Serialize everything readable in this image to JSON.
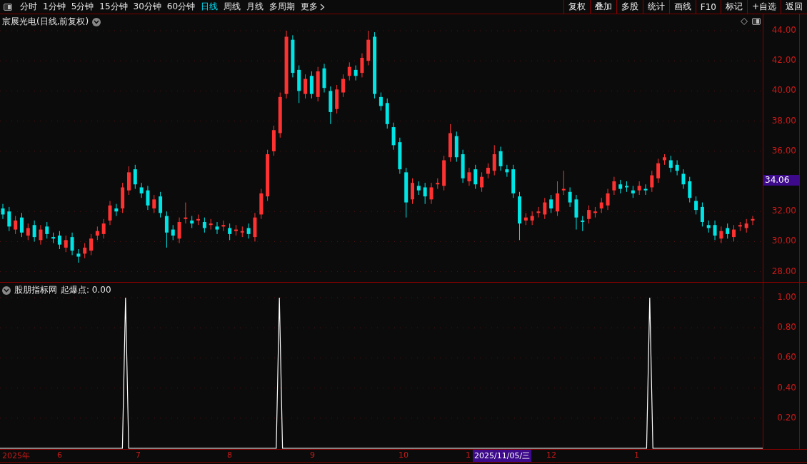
{
  "toolbar": {
    "periods": [
      {
        "label": "分时",
        "selected": false
      },
      {
        "label": "1分钟",
        "selected": false
      },
      {
        "label": "5分钟",
        "selected": false
      },
      {
        "label": "15分钟",
        "selected": false
      },
      {
        "label": "30分钟",
        "selected": false
      },
      {
        "label": "60分钟",
        "selected": false
      },
      {
        "label": "日线",
        "selected": true
      },
      {
        "label": "周线",
        "selected": false
      },
      {
        "label": "月线",
        "selected": false
      },
      {
        "label": "多周期",
        "selected": false
      },
      {
        "label": "更多",
        "selected": false
      }
    ],
    "actions": [
      "复权",
      "叠加",
      "多股",
      "统计",
      "画线",
      "F10",
      "标记",
      "+自选",
      "返回"
    ]
  },
  "main_chart": {
    "title": "宸展光电(日线,前复权)",
    "last_price": "34.06",
    "chart_data": {
      "type": "candlestick",
      "categories": [
        null,
        null,
        null,
        null,
        null,
        null,
        null,
        null,
        null,
        null,
        null,
        null,
        null,
        null,
        null,
        null,
        null,
        null,
        null,
        null,
        null,
        null,
        null,
        null,
        null,
        null,
        null,
        null,
        null,
        null,
        null,
        null,
        null,
        null,
        null,
        null,
        null,
        null,
        null,
        null,
        null,
        null,
        null,
        null,
        null,
        null,
        null,
        null,
        null,
        null,
        null,
        null,
        null,
        null,
        null,
        null,
        null,
        null,
        null,
        null,
        null,
        null,
        null,
        null,
        null,
        null,
        null,
        null,
        null,
        null,
        null,
        null,
        null,
        null,
        null,
        null,
        null,
        null,
        null,
        null,
        null,
        null,
        null,
        null,
        null,
        null,
        null,
        null,
        null,
        null,
        null,
        null,
        null,
        null,
        null,
        null,
        null,
        null,
        null,
        null,
        null,
        null,
        null,
        null,
        null,
        null,
        null,
        null,
        null,
        null,
        null,
        null,
        null,
        null,
        null,
        null,
        null,
        null,
        null,
        null
      ],
      "ohlc": [
        [
          32.2,
          32.5,
          31.5,
          31.8
        ],
        [
          32.0,
          32.3,
          30.7,
          31.0
        ],
        [
          30.8,
          31.7,
          30.5,
          31.4
        ],
        [
          31.6,
          31.9,
          30.3,
          30.6
        ],
        [
          30.4,
          31.2,
          30.1,
          30.9
        ],
        [
          31.1,
          31.4,
          30.0,
          30.3
        ],
        [
          30.1,
          31.1,
          29.8,
          30.8
        ],
        [
          31.0,
          31.3,
          30.2,
          30.5
        ],
        [
          30.3,
          30.6,
          29.9,
          30.2
        ],
        [
          30.4,
          30.7,
          29.5,
          29.8
        ],
        [
          29.6,
          30.4,
          29.3,
          30.1
        ],
        [
          30.3,
          30.6,
          29.1,
          29.4
        ],
        [
          29.2,
          29.5,
          28.6,
          29.0
        ],
        [
          29.2,
          29.9,
          28.9,
          29.6
        ],
        [
          29.4,
          30.5,
          29.1,
          30.2
        ],
        [
          30.4,
          31.0,
          30.1,
          30.7
        ],
        [
          30.5,
          31.5,
          30.2,
          31.2
        ],
        [
          31.4,
          32.7,
          31.1,
          32.4
        ],
        [
          32.2,
          32.5,
          31.7,
          32.0
        ],
        [
          32.2,
          33.9,
          31.9,
          33.6
        ],
        [
          33.4,
          35.0,
          33.1,
          34.6
        ],
        [
          34.8,
          35.1,
          33.5,
          33.8
        ],
        [
          33.6,
          33.9,
          32.9,
          33.2
        ],
        [
          33.4,
          33.7,
          32.1,
          32.4
        ],
        [
          32.2,
          33.1,
          31.9,
          32.8
        ],
        [
          33.0,
          33.3,
          31.6,
          31.9
        ],
        [
          31.7,
          32.0,
          29.6,
          30.6
        ],
        [
          30.8,
          31.1,
          30.1,
          30.4
        ],
        [
          30.2,
          31.6,
          29.9,
          31.3
        ],
        [
          31.5,
          32.6,
          31.2,
          31.6
        ],
        [
          31.4,
          31.7,
          30.9,
          31.2
        ],
        [
          31.4,
          31.8,
          31.1,
          31.5
        ],
        [
          31.3,
          31.6,
          30.6,
          30.9
        ],
        [
          31.1,
          31.5,
          30.8,
          31.2
        ],
        [
          31.0,
          31.3,
          30.5,
          30.8
        ],
        [
          31.0,
          31.4,
          30.7,
          31.1
        ],
        [
          30.9,
          31.2,
          30.1,
          30.5
        ],
        [
          30.7,
          31.1,
          30.4,
          30.8
        ],
        [
          30.6,
          31.0,
          30.3,
          30.7
        ],
        [
          30.9,
          31.2,
          30.2,
          30.5
        ],
        [
          30.3,
          31.9,
          30.0,
          31.6
        ],
        [
          31.8,
          33.5,
          31.5,
          33.2
        ],
        [
          33.0,
          36.1,
          32.7,
          35.8
        ],
        [
          36.0,
          37.7,
          35.7,
          37.4
        ],
        [
          37.2,
          39.9,
          36.9,
          39.6
        ],
        [
          39.8,
          44.0,
          39.5,
          43.6
        ],
        [
          43.4,
          43.7,
          40.9,
          41.2
        ],
        [
          41.4,
          41.7,
          39.2,
          40.0
        ],
        [
          39.8,
          41.1,
          39.5,
          40.8
        ],
        [
          41.0,
          41.3,
          39.5,
          39.8
        ],
        [
          39.6,
          41.6,
          39.3,
          41.3
        ],
        [
          41.5,
          41.8,
          39.9,
          40.2
        ],
        [
          40.0,
          40.3,
          37.8,
          38.6
        ],
        [
          38.8,
          40.4,
          38.5,
          40.1
        ],
        [
          39.9,
          41.1,
          39.6,
          40.8
        ],
        [
          41.0,
          41.9,
          40.7,
          41.6
        ],
        [
          41.4,
          41.7,
          40.7,
          41.0
        ],
        [
          41.2,
          42.5,
          40.9,
          42.2
        ],
        [
          42.0,
          44.0,
          41.7,
          43.4
        ],
        [
          43.6,
          43.9,
          39.5,
          39.8
        ],
        [
          39.6,
          39.9,
          38.7,
          39.0
        ],
        [
          39.2,
          39.5,
          37.5,
          37.8
        ],
        [
          37.6,
          37.9,
          36.1,
          36.4
        ],
        [
          36.6,
          36.9,
          34.5,
          34.8
        ],
        [
          34.6,
          34.9,
          31.6,
          32.6
        ],
        [
          32.8,
          34.2,
          32.5,
          33.9
        ],
        [
          33.7,
          34.0,
          33.1,
          33.4
        ],
        [
          33.6,
          33.9,
          32.5,
          33.0
        ],
        [
          32.8,
          33.9,
          32.5,
          33.6
        ],
        [
          33.8,
          34.2,
          33.5,
          33.9
        ],
        [
          33.7,
          35.7,
          33.4,
          35.4
        ],
        [
          35.6,
          37.8,
          35.3,
          37.2
        ],
        [
          37.0,
          37.3,
          35.3,
          35.6
        ],
        [
          35.8,
          36.1,
          33.9,
          34.2
        ],
        [
          34.0,
          34.9,
          33.7,
          34.6
        ],
        [
          34.8,
          35.1,
          33.5,
          33.8
        ],
        [
          33.6,
          34.6,
          33.3,
          34.3
        ],
        [
          34.5,
          35.2,
          34.2,
          34.9
        ],
        [
          34.7,
          36.4,
          34.4,
          35.8
        ],
        [
          36.0,
          36.3,
          34.7,
          35.0
        ],
        [
          34.8,
          35.1,
          34.3,
          34.6
        ],
        [
          34.8,
          35.1,
          32.9,
          33.2
        ],
        [
          33.0,
          33.3,
          30.1,
          31.2
        ],
        [
          31.4,
          31.9,
          31.1,
          31.6
        ],
        [
          31.4,
          32.0,
          31.1,
          31.7
        ],
        [
          31.9,
          32.3,
          31.6,
          32.0
        ],
        [
          31.8,
          32.9,
          31.5,
          32.6
        ],
        [
          32.8,
          33.1,
          31.9,
          32.2
        ],
        [
          32.0,
          34.0,
          31.7,
          33.2
        ],
        [
          33.4,
          34.7,
          33.1,
          33.5
        ],
        [
          33.3,
          33.6,
          32.3,
          32.6
        ],
        [
          32.8,
          33.1,
          30.8,
          31.6
        ],
        [
          31.4,
          31.7,
          30.7,
          31.3
        ],
        [
          31.5,
          32.4,
          31.2,
          32.1
        ],
        [
          31.9,
          32.3,
          31.6,
          32.0
        ],
        [
          32.2,
          32.9,
          31.9,
          32.6
        ],
        [
          32.4,
          33.5,
          32.1,
          33.2
        ],
        [
          33.4,
          34.3,
          33.1,
          34.0
        ],
        [
          33.8,
          34.1,
          33.2,
          33.5
        ],
        [
          33.7,
          34.0,
          33.3,
          33.6
        ],
        [
          33.4,
          33.7,
          32.9,
          33.2
        ],
        [
          33.4,
          34.0,
          33.1,
          33.7
        ],
        [
          33.5,
          33.8,
          33.1,
          33.4
        ],
        [
          33.6,
          34.7,
          33.3,
          34.4
        ],
        [
          34.2,
          35.5,
          33.9,
          35.2
        ],
        [
          35.4,
          35.8,
          35.1,
          35.6
        ],
        [
          35.4,
          35.7,
          34.6,
          34.9
        ],
        [
          35.1,
          35.4,
          34.4,
          34.7
        ],
        [
          34.5,
          34.8,
          33.5,
          33.8
        ],
        [
          34.0,
          34.3,
          32.6,
          32.9
        ],
        [
          32.7,
          33.0,
          31.8,
          32.1
        ],
        [
          32.3,
          32.6,
          31.0,
          31.3
        ],
        [
          31.1,
          31.4,
          30.6,
          30.9
        ],
        [
          31.1,
          31.4,
          30.1,
          30.4
        ],
        [
          30.2,
          31.0,
          29.9,
          30.7
        ],
        [
          30.9,
          31.2,
          30.2,
          30.5
        ],
        [
          30.3,
          31.1,
          30.0,
          30.8
        ],
        [
          31.0,
          31.3,
          30.7,
          31.1
        ],
        [
          30.9,
          31.5,
          30.6,
          31.2
        ],
        [
          31.4,
          31.7,
          31.1,
          31.5
        ]
      ],
      "ylim": [
        27.32,
        45.09
      ],
      "grid": true,
      "yticks": [
        {
          "value": 44,
          "label": "44.00"
        },
        {
          "value": 42,
          "label": "42.00"
        },
        {
          "value": 40,
          "label": "40.00"
        },
        {
          "value": 38,
          "label": "38.00"
        },
        {
          "value": 36,
          "label": "36.00"
        },
        {
          "value": 32,
          "label": "32.00"
        },
        {
          "value": 30,
          "label": "30.00"
        },
        {
          "value": 28,
          "label": "28.00"
        }
      ]
    }
  },
  "indicator": {
    "name": "股朋指标网",
    "reading": "起爆点: 0.00",
    "chart_data": {
      "type": "line",
      "categories": [
        null,
        null,
        null,
        null,
        null,
        null,
        null,
        null,
        null,
        null,
        null,
        null,
        null,
        null,
        null,
        null,
        null,
        null,
        null,
        null,
        null,
        null,
        null,
        null,
        null,
        null,
        null,
        null,
        null,
        null,
        null,
        null,
        null,
        null,
        null,
        null,
        null,
        null,
        null,
        null,
        null,
        null,
        null,
        null,
        null,
        null,
        null,
        null,
        null,
        null,
        null,
        null,
        null,
        null,
        null,
        null,
        null,
        null,
        null,
        null,
        null,
        null,
        null,
        null,
        null,
        null,
        null,
        null,
        null,
        null,
        null,
        null,
        null,
        null,
        null,
        null,
        null,
        null,
        null,
        null,
        null,
        null,
        null,
        null,
        null,
        null,
        null,
        null,
        null,
        null,
        null,
        null,
        null,
        null,
        null,
        null,
        null,
        null,
        null,
        null,
        null,
        null,
        null,
        null,
        null,
        null,
        null,
        null,
        null,
        null,
        null,
        null,
        null,
        null,
        null,
        null,
        null,
        null,
        null,
        null,
        null,
        null,
        null,
        null,
        null,
        null,
        null,
        null,
        null,
        null,
        null,
        null,
        null,
        null,
        null,
        null,
        null,
        null,
        null,
        null,
        null,
        null,
        null,
        null,
        null,
        null,
        null,
        null,
        null,
        null,
        null,
        null,
        null,
        null,
        null,
        null,
        null,
        null,
        null,
        null,
        null,
        null,
        null,
        null,
        null,
        null,
        null,
        null,
        null,
        null,
        null,
        null,
        null,
        null,
        null,
        null,
        null,
        null,
        null,
        null,
        null,
        null,
        null,
        null,
        null,
        null,
        null,
        null,
        null,
        null,
        null,
        null,
        null,
        null,
        null,
        null,
        null,
        null,
        null,
        null,
        null,
        null,
        null,
        null,
        null,
        null,
        null,
        null,
        null,
        null,
        null,
        null,
        null,
        null,
        null,
        null,
        null,
        null,
        null,
        null,
        null,
        null,
        null,
        null,
        null,
        null,
        null,
        null,
        null,
        null,
        null,
        null,
        null,
        null,
        null,
        null,
        null,
        null,
        null,
        null,
        null,
        null,
        null,
        null
      ],
      "series": [
        {
          "color": "#ffffff",
          "values": [
            0,
            0,
            0,
            0,
            0,
            0,
            0,
            0,
            0,
            0,
            0,
            0,
            0,
            0,
            0,
            0,
            0,
            0,
            0,
            0,
            0,
            0,
            0,
            0,
            0,
            0,
            0,
            0,
            0,
            0,
            0,
            0,
            0,
            0,
            0,
            0,
            0,
            0,
            0,
            0,
            1,
            0,
            0,
            0,
            0,
            0,
            0,
            0,
            0,
            0,
            0,
            0,
            0,
            0,
            0,
            0,
            0,
            0,
            0,
            0,
            0,
            0,
            0,
            0,
            0,
            0,
            0,
            0,
            0,
            0,
            0,
            0,
            0,
            0,
            0,
            0,
            0,
            0,
            0,
            0,
            0,
            0,
            0,
            0,
            0,
            0,
            0,
            0,
            0,
            1,
            0,
            0,
            0,
            0,
            0,
            0,
            0,
            0,
            0,
            0,
            0,
            0,
            0,
            0,
            0,
            0,
            0,
            0,
            0,
            0,
            0,
            0,
            0,
            0,
            0,
            0,
            0,
            0,
            0,
            0,
            0,
            0,
            0,
            0,
            0,
            0,
            0,
            0,
            0,
            0,
            0,
            0,
            0,
            0,
            0,
            0,
            0,
            0,
            0,
            0,
            0,
            0,
            0,
            0,
            0,
            0,
            0,
            0,
            0,
            0,
            0,
            0,
            0,
            0,
            0,
            0,
            0,
            0,
            0,
            0,
            0,
            0,
            0,
            0,
            0,
            0,
            0,
            0,
            0,
            0,
            0,
            0,
            0,
            0,
            0,
            0,
            0,
            0,
            0,
            0,
            0,
            0,
            0,
            0,
            0,
            0,
            0,
            0,
            0,
            0,
            0,
            0,
            0,
            0,
            0,
            0,
            0,
            0,
            0,
            0,
            0,
            0,
            0,
            0,
            0,
            0,
            0,
            1,
            0,
            0,
            0,
            0,
            0,
            0,
            0,
            0,
            0,
            0,
            0,
            0,
            0,
            0,
            0,
            0,
            0,
            0,
            0,
            0,
            0,
            0,
            0,
            0,
            0,
            0,
            0,
            0,
            0,
            0,
            0,
            0,
            0,
            0,
            0,
            0
          ]
        }
      ],
      "ylim": [
        0,
        1
      ],
      "grid": true,
      "yticks": [
        {
          "value": 0.2,
          "label": "0.20"
        },
        {
          "value": 0.4,
          "label": "0.40"
        },
        {
          "value": 0.6,
          "label": "0.60"
        },
        {
          "value": 0.8,
          "label": "0.80"
        },
        {
          "value": 1,
          "label": "1.00"
        }
      ]
    }
  },
  "x_axis": {
    "labels": [
      "2025年",
      "6",
      "7",
      "8",
      "9",
      "10",
      "1",
      "12",
      "1"
    ],
    "cursor_date": "2025/11/05/三"
  }
}
